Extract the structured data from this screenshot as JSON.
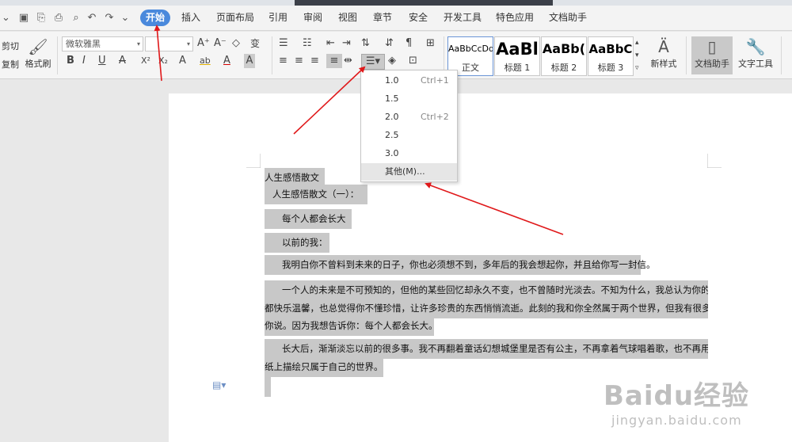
{
  "tabs": [
    "开始",
    "插入",
    "页面布局",
    "引用",
    "审阅",
    "视图",
    "章节",
    "安全",
    "开发工具",
    "特色应用",
    "文档助手"
  ],
  "active_tab": "开始",
  "clipboard": {
    "cut": "剪切",
    "copy": "复制",
    "format_painter": "格式刷"
  },
  "font": {
    "name": "微软雅黑",
    "size": ""
  },
  "font_buttons": {
    "grow": "A⁺",
    "shrink": "A⁻",
    "clear": "◇",
    "phonetic": "变",
    "bold": "B",
    "italic": "I",
    "underline": "U",
    "strike": "A",
    "superscript": "X²",
    "subscript": "X₂",
    "effects": "A",
    "highlight": "ab",
    "color": "A",
    "shade": "A"
  },
  "styles": [
    {
      "preview": "AaBbCcDd",
      "name": "正文"
    },
    {
      "preview": "AaBl",
      "name": "标题 1"
    },
    {
      "preview": "AaBb(",
      "name": "标题 2"
    },
    {
      "preview": "AaBbC",
      "name": "标题 3"
    }
  ],
  "new_style": "新样式",
  "doc_assistant": "文档助手",
  "text_tools": "文字工具",
  "line_spacing_menu": {
    "items": [
      {
        "value": "1.0",
        "shortcut": "Ctrl+1"
      },
      {
        "value": "1.5",
        "shortcut": ""
      },
      {
        "value": "2.0",
        "shortcut": "Ctrl+2"
      },
      {
        "value": "2.5",
        "shortcut": ""
      },
      {
        "value": "3.0",
        "shortcut": ""
      },
      {
        "value": "其他(M)...",
        "shortcut": ""
      }
    ]
  },
  "document": {
    "lines": [
      "人生感悟散文",
      "人生感悟散文（一）：",
      "每个人都会长大",
      "以前的我：",
      "我明白你不曾料到未来的日子，你也必须想不到，多年后的我会想起你，并且给你写一封信。",
      "一个人的未来是不可预知的，但他的某些回忆却永久不变，也不曾随时光淡去。不知为什么，我总认为你的每一天",
      "都快乐温馨，也总觉得你不懂珍惜，让许多珍贵的东西悄悄流逝。此刻的我和你全然属于两个世界，但我有很多话要对",
      "你说。因为我想告诉你：每个人都会长大。",
      "长大后，渐渐淡忘以前的很多事。我不再翻着童话幻想城堡里是否有公主，不再拿着气球唱着歌，也不再用蜡笔在",
      "纸上描绘只属于自己的世界。"
    ]
  },
  "watermark": {
    "logo": "Baidu经验",
    "url": "jingyan.baidu.com"
  },
  "colors": {
    "accent": "#4a89dc",
    "arrow": "#e0191b",
    "selection": "#c8c8c8"
  }
}
